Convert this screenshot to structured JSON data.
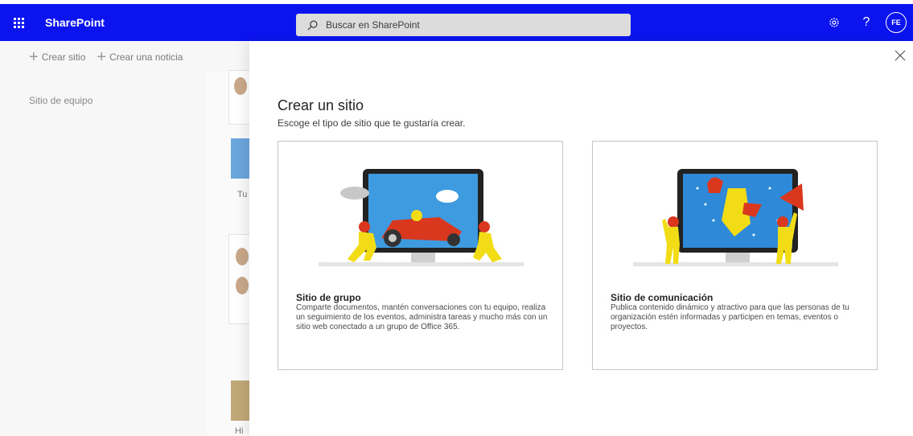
{
  "topbar": {
    "app_name": "SharePoint",
    "search_placeholder": "Buscar en SharePoint",
    "help_label": "?",
    "avatar_initials": "FE"
  },
  "commands": {
    "create_site": "Crear sitio",
    "create_news": "Crear una noticia"
  },
  "leftnav": {
    "item": "Sitio de equipo"
  },
  "background": {
    "text_1": "Tu",
    "text_2": "Hi"
  },
  "panel": {
    "title": "Crear un sitio",
    "subtitle": "Escoge el tipo de sitio que te gustaría crear.",
    "options": [
      {
        "title": "Sitio de grupo",
        "description": "Comparte documentos, mantén conversaciones con tu equipo, realiza un seguimiento de los eventos, administra tareas y mucho más con un sitio web conectado a un grupo de Office 365."
      },
      {
        "title": "Sitio de comunicación",
        "description": "Publica contenido dinámico y atractivo para que las personas de tu organización estén informadas y participen en temas, eventos o proyectos."
      }
    ]
  },
  "colors": {
    "suite_bar": "#0b14ee",
    "accent_blue": "#2e8ad8",
    "figure_yellow": "#f2dc16",
    "figure_red": "#d9381e"
  }
}
